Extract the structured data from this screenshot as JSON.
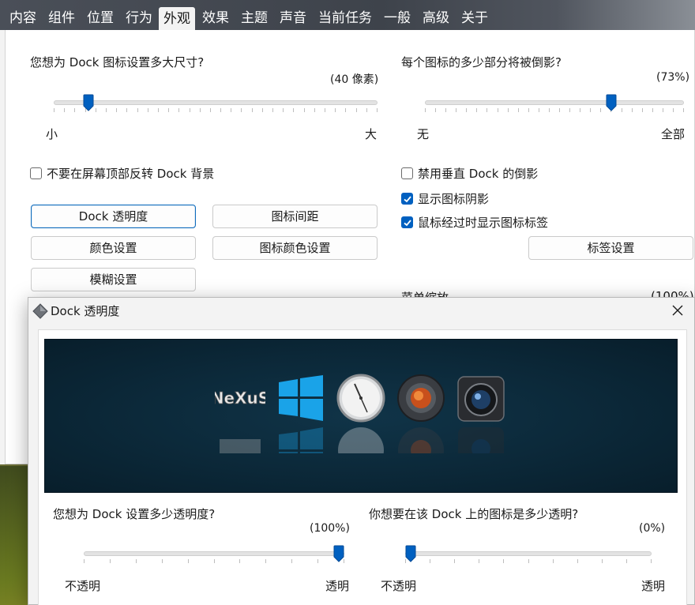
{
  "tabs": [
    "内容",
    "组件",
    "位置",
    "行为",
    "外观",
    "效果",
    "主题",
    "声音",
    "当前任务",
    "一般",
    "高级",
    "关于"
  ],
  "active_tab": "外观",
  "size": {
    "question": "您想为 Dock 图标设置多大尺寸?",
    "value_text": "(40 像素)",
    "value_fraction": 0.11,
    "min_label": "小",
    "max_label": "大"
  },
  "reflection": {
    "question": "每个图标的多少部分将被倒影?",
    "value_text": "(73%)",
    "value_fraction": 0.73,
    "min_label": "无",
    "max_label": "全部"
  },
  "checkboxes": {
    "no_flip": {
      "label": "不要在屏幕顶部反转 Dock 背景",
      "checked": false
    },
    "disable_vertical_reflection": {
      "label": "禁用垂直 Dock 的倒影",
      "checked": false
    },
    "show_icon_shadow": {
      "label": "显示图标阴影",
      "checked": true
    },
    "show_labels_on_hover": {
      "label": "鼠标经过时显示图标标签",
      "checked": true
    }
  },
  "buttons": {
    "dock_transparency": "Dock 透明度",
    "icon_spacing": "图标间距",
    "color_settings": "颜色设置",
    "icon_color_settings": "图标颜色设置",
    "blur_settings": "模糊设置",
    "label_settings": "标签设置"
  },
  "clipped_text": {
    "left": "菜单缩放",
    "right": "(100%)"
  },
  "dialog": {
    "title": "Dock 透明度",
    "dock_icons": [
      "nexus-logo",
      "windows-logo",
      "clock",
      "orb",
      "camera"
    ],
    "nexus_text": "NeXuS",
    "dock_opacity": {
      "question": "您想为 Dock 设置多少透明度?",
      "value_text": "(100%)",
      "value_fraction": 1.0,
      "min_label": "不透明",
      "max_label": "透明"
    },
    "icon_opacity": {
      "question": "你想要在该 Dock 上的图标是多少透明?",
      "value_text": "(0%)",
      "value_fraction": 0.0,
      "min_label": "不透明",
      "max_label": "透明"
    }
  },
  "colors": {
    "accent": "#0060c0",
    "tabbar": "#3e434b",
    "preview_bg": "#0b2737"
  }
}
